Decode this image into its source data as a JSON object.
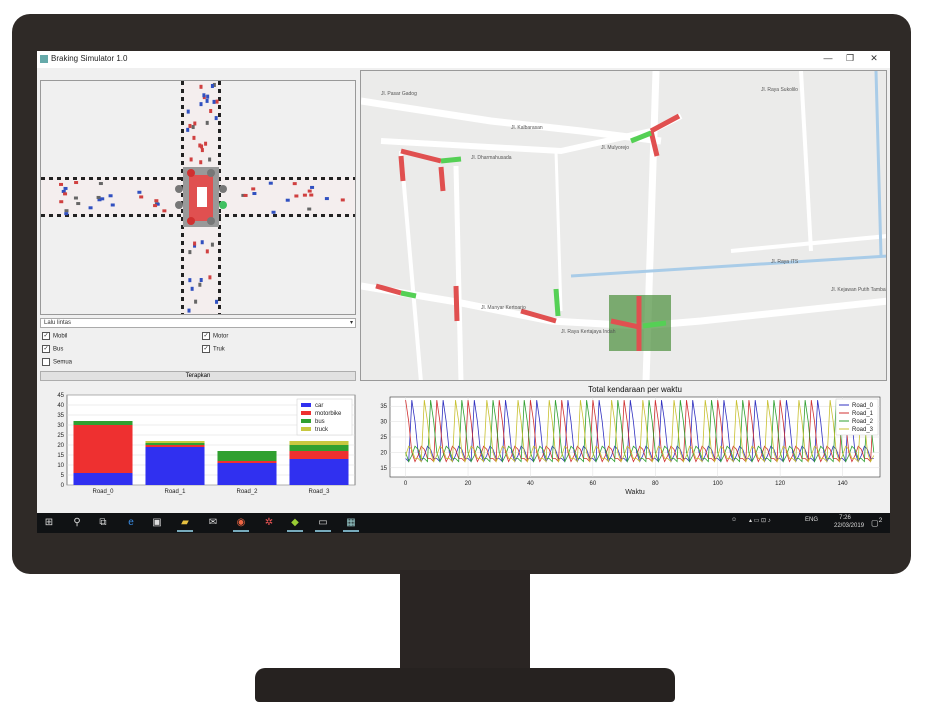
{
  "window": {
    "title": "Braking Simulator 1.0",
    "min": "—",
    "max": "❐",
    "close": "✕"
  },
  "dropdown": {
    "value": "Lalu lintas",
    "arrow": "▾"
  },
  "checkboxes": [
    {
      "label": "Mobil",
      "checked": true
    },
    {
      "label": "Motor",
      "checked": true
    },
    {
      "label": "Bus",
      "checked": true
    },
    {
      "label": "Truk",
      "checked": true
    },
    {
      "label": "Semua",
      "checked": false
    }
  ],
  "apply_label": "Terapkan",
  "map_labels": [
    "Jl. Pasar Gadog",
    "Jl. Kalbarasan",
    "Jl. Dharmahusada",
    "Jl. Mulyorejo",
    "Jl. Manyar Kertoarjo",
    "Jl. Raya Kertajaya Indah",
    "Jl. Raya ITS",
    "Jl. Raya Sukolilo",
    "Jl. Kejawan Putih Tambak"
  ],
  "chart_data": [
    {
      "type": "bar",
      "stacked": true,
      "categories": [
        "Road_0",
        "Road_1",
        "Road_2",
        "Road_3"
      ],
      "series": [
        {
          "name": "car",
          "color": "#3030f0",
          "values": [
            6,
            19,
            11,
            13
          ]
        },
        {
          "name": "motorbike",
          "color": "#ee3030",
          "values": [
            24,
            1,
            1,
            4
          ]
        },
        {
          "name": "bus",
          "color": "#30a030",
          "values": [
            2,
            1,
            5,
            3
          ]
        },
        {
          "name": "truck",
          "color": "#c8c840",
          "values": [
            0,
            1,
            0,
            2
          ]
        }
      ],
      "yticks": [
        0,
        5,
        10,
        15,
        20,
        25,
        30,
        35,
        40,
        45
      ],
      "ylim": [
        0,
        45
      ],
      "grid": true,
      "legend": "top-right"
    },
    {
      "type": "line",
      "title": "Total kendaraan per waktu",
      "xlabel": "Waktu",
      "xticks": [
        0,
        20,
        40,
        60,
        80,
        100,
        120,
        140
      ],
      "yticks": [
        15,
        20,
        25,
        30,
        35
      ],
      "xlim": [
        -5,
        152
      ],
      "ylim": [
        12,
        38
      ],
      "grid": true,
      "legend": "top-right",
      "series": [
        {
          "name": "Road_0",
          "color": "#3030c0",
          "offset": 0
        },
        {
          "name": "Road_1",
          "color": "#d03030",
          "offset": 1
        },
        {
          "name": "Road_2",
          "color": "#30a030",
          "offset": 2
        },
        {
          "name": "Road_3",
          "color": "#c8c030",
          "offset": 3
        }
      ],
      "pattern": [
        18,
        17,
        37,
        30,
        20,
        17,
        19,
        22,
        21,
        18
      ]
    }
  ],
  "taskbar": {
    "time": "7:26",
    "date": "22/03/2019",
    "lang": "ENG",
    "notif": "2"
  }
}
